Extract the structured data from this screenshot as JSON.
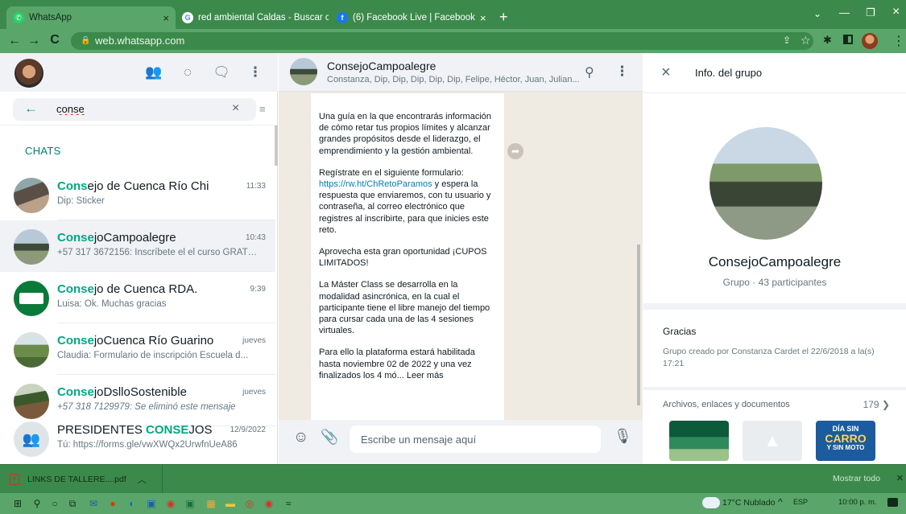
{
  "browser": {
    "tabs": [
      {
        "label": "WhatsApp",
        "active": true
      },
      {
        "label": "red ambiental Caldas - Buscar co",
        "active": false
      },
      {
        "label": "(6) Facebook Live | Facebook",
        "active": false
      }
    ],
    "new_tab": "+",
    "url": "web.whatsapp.com"
  },
  "search": {
    "value": "conse"
  },
  "chats_label": "CHATS",
  "chats": [
    {
      "hl": "Cons",
      "rest": "ejo de Cuenca Río Chi",
      "time": "11:33",
      "msg": "Dip: Sticker"
    },
    {
      "hl": "Conse",
      "rest": "joCampoalegre",
      "time": "10:43",
      "msg": "+57 317 3672156: Inscríbete el el curso GRATUI..."
    },
    {
      "hl": "Conse",
      "rest": "jo de Cuenca RDA.",
      "time": "9:39",
      "msg": "Luisa: Ok. Muchas gracias"
    },
    {
      "hl": "Conse",
      "rest": "joCuenca Río Guarino",
      "time": "jueves",
      "msg": "Claudia: Formulario de inscripción Escuela d..."
    },
    {
      "hl": "Conse",
      "rest": "joDslloSostenible",
      "time": "jueves",
      "msg": "+57 318 7129979: Se eliminó este mensaje"
    },
    {
      "pre": "PRESIDENTES ",
      "hl": "CONSE",
      "rest": "JOS",
      "time": "12/9/2022",
      "msg": "Tú: https://forms.gle/vwXWQx2UrwfnUeA86"
    }
  ],
  "conversation": {
    "title": "ConsejoCampoalegre",
    "participants": "Constanza, Dip, Dip, Dip, Dip, Dip, Felipe, Héctor, Juan, Julian...",
    "p1": "Una guía en la que encontrarás información de cómo retar tus propios límites y alcanzar grandes propósitos desde el liderazgo, el emprendimiento y la gestión ambiental.",
    "p2_a": "Regístrate en el siguiente formulario:",
    "p2_link": "https://rw.ht/ChRetoParamos",
    "p2_b": " y espera la respuesta que enviaremos, con tu usuario y contraseña, al correo electrónico que registres al inscribirte, para que inicies este reto.",
    "p3": "Aprovecha esta gran oportunidad ¡CUPOS LIMITADOS!",
    "p4": "La Máster Class se desarrolla en la modalidad asincrónica, en la cual el participante tiene el libre manejo del tiempo para cursar cada una de las 4 sesiones virtuales.",
    "p5": "Para ello la plataforma estará habilitada hasta noviembre 02 de 2022 y una vez finalizados los 4 mó... Leer más",
    "composer_placeholder": "Escribe un mensaje aquí"
  },
  "group_info": {
    "header_title": "Info. del grupo",
    "name": "ConsejoCampoalegre",
    "meta": "Grupo · 43 participantes",
    "description": "Gracias",
    "created": "Grupo creado por Constanza Cardet el 22/6/2018 a la(s) 17:21",
    "files_label": "Archivos, enlaces y documentos",
    "files_count": "179",
    "thumb3_line1": "DÍA SIN",
    "thumb3_line2": "CARRO",
    "thumb3_line3": "Y SIN MOTO"
  },
  "download": {
    "file": "LINKS DE TALLERE....pdf",
    "show_all": "Mostrar todo"
  },
  "taskbar": {
    "weather": "17°C Nublado",
    "lang": "ESP",
    "time": "10:00 p. m."
  },
  "colors": {
    "accent": "#00a884",
    "browser_green": "#3c8a4b"
  }
}
